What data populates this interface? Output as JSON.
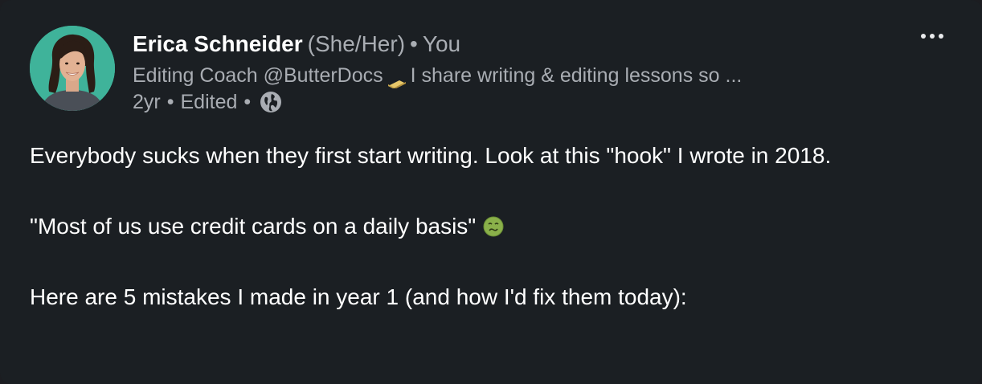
{
  "post": {
    "author": {
      "name": "Erica Schneider",
      "pronouns": "(She/Her)",
      "separator": "•",
      "relation": "You",
      "headline_prefix": "Editing Coach @ButterDocs",
      "headline_suffix": "I share writing & editing lessons so ...",
      "headline_emoji": "butter-icon"
    },
    "meta": {
      "age": "2yr",
      "separator": "•",
      "edited": "Edited",
      "visibility_icon": "globe-icon"
    },
    "menu_icon": "more-options-icon",
    "body": {
      "line1": "Everybody sucks when they first start writing. Look at this \"hook\" I wrote in 2018.",
      "line2": "\"Most of us use credit cards on a daily basis\"",
      "line2_emoji": "nauseated-face-icon",
      "line3": "Here are 5 mistakes I made in year 1 (and how I'd fix them today):"
    },
    "colors": {
      "background": "#1b1f23",
      "primary_text": "#ffffff",
      "secondary_text": "#a9adb3",
      "avatar_bg": "#3fb39a"
    }
  }
}
